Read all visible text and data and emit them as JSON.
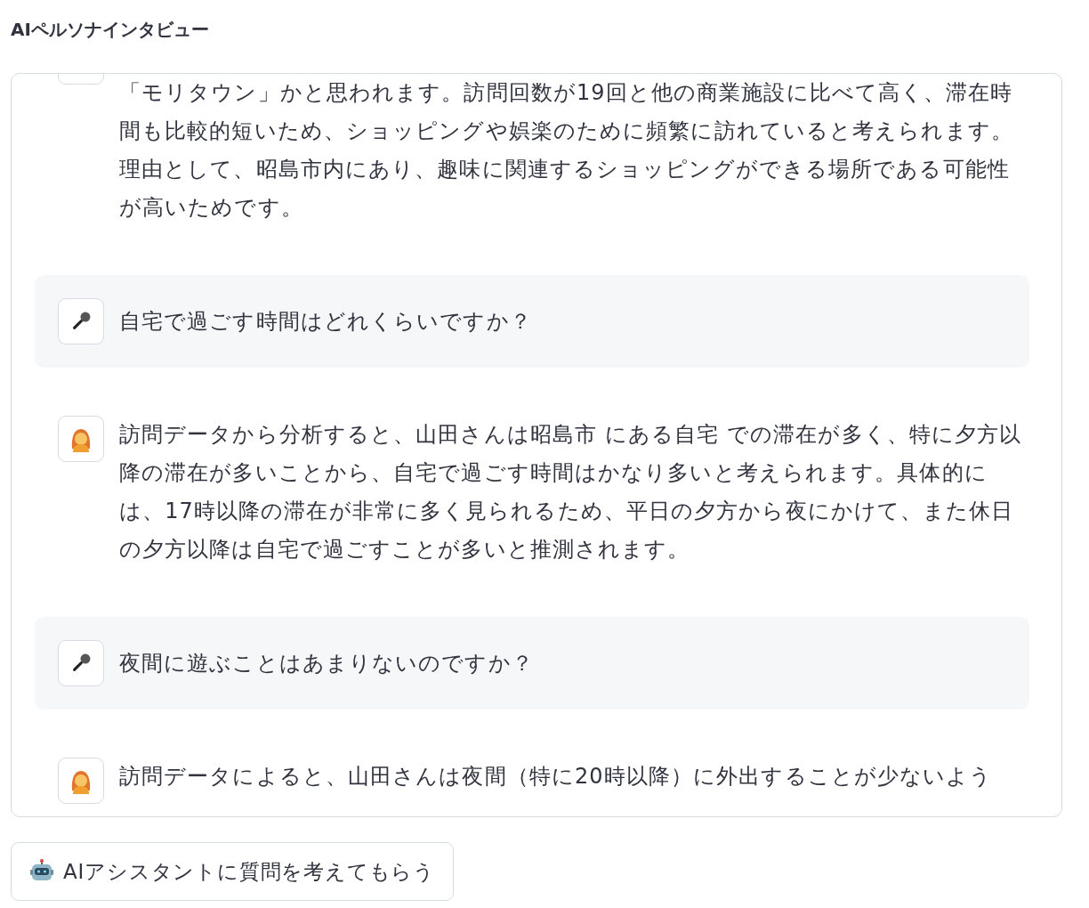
{
  "title": "AIペルソナインタビュー",
  "messages": [
    {
      "kind": "answer_continued",
      "text": "「モリタウン」かと思われます。訪問回数が19回と他の商業施設に比べて高く、滞在時間も比較的短いため、ショッピングや娯楽のために頻繁に訪れていると考えられます。理由として、昭島市内にあり、趣味に関連するショッピングができる場所である可能性が高いためです。"
    },
    {
      "kind": "question",
      "text": "自宅で過ごす時間はどれくらいですか？"
    },
    {
      "kind": "answer",
      "text": "訪問データから分析すると、山田さんは昭島市 にある自宅 での滞在が多く、特に夕方以降の滞在が多いことから、自宅で過ごす時間はかなり多いと考えられます。具体的には、17時以降の滞在が非常に多く見られるため、平日の夕方から夜にかけて、また休日の夕方以降は自宅で過ごすことが多いと推測されます。"
    },
    {
      "kind": "question",
      "text": "夜間に遊ぶことはあまりないのですか？"
    },
    {
      "kind": "answer",
      "text": "訪問データによると、山田さんは夜間（特に20時以降）に外出することが少ないよう"
    }
  ],
  "assist_button": "AIアシスタントに質問を考えてもらう"
}
